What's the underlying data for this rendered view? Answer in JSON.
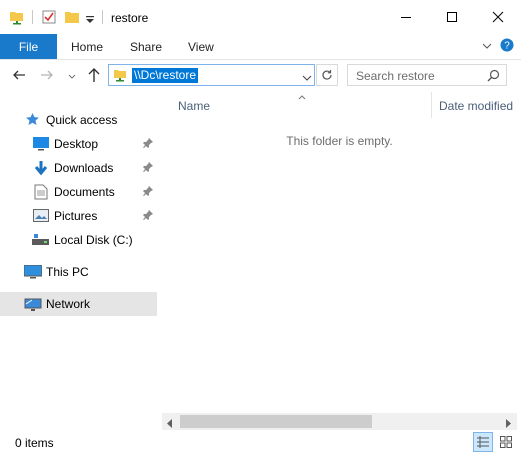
{
  "window": {
    "title": "restore"
  },
  "ribbon": {
    "tabs": [
      "File",
      "Home",
      "Share",
      "View"
    ]
  },
  "address_bar": {
    "path": "\\\\Dc\\restore"
  },
  "search": {
    "placeholder": "Search restore"
  },
  "nav_pane": {
    "quick_access": "Quick access",
    "pinned": [
      {
        "label": "Desktop",
        "icon": "desktop-icon"
      },
      {
        "label": "Downloads",
        "icon": "downloads-icon"
      },
      {
        "label": "Documents",
        "icon": "documents-icon"
      },
      {
        "label": "Pictures",
        "icon": "pictures-icon"
      }
    ],
    "local_disk": "Local Disk (C:)",
    "this_pc": "This PC",
    "network": "Network"
  },
  "content": {
    "columns": [
      "Name",
      "Date modified"
    ],
    "empty_message": "This folder is empty."
  },
  "status": {
    "item_count": "0 items"
  },
  "colors": {
    "accent": "#1979ca",
    "selection": "#0078d7",
    "nav_selected_bg": "#e5e5e5",
    "folder_yellow": "#f4c94b"
  }
}
